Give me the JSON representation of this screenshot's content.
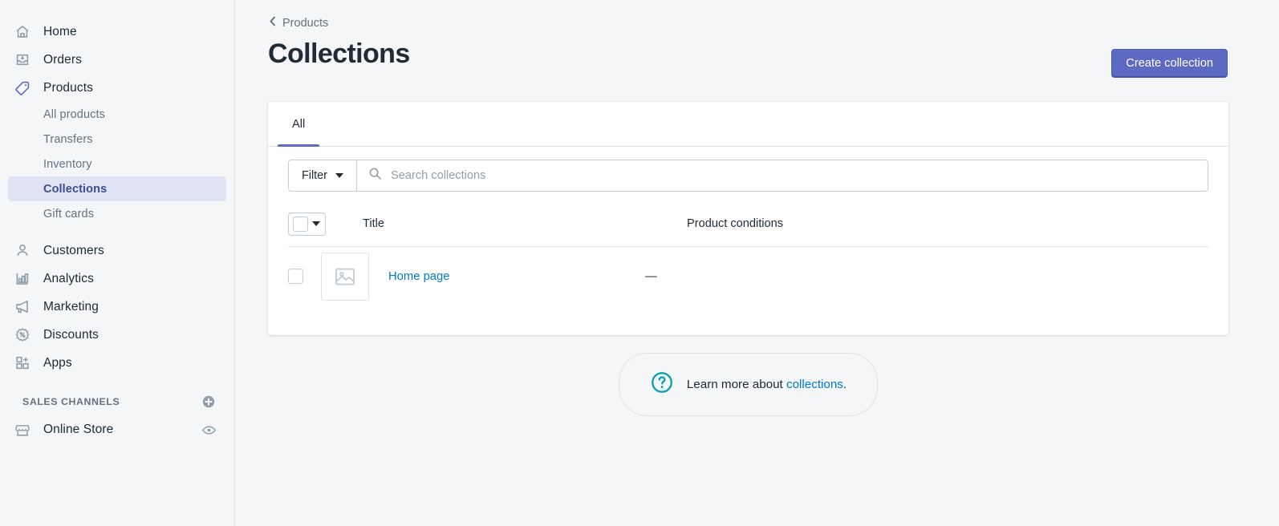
{
  "sidebar": {
    "items": [
      {
        "label": "Home",
        "icon": "home-icon"
      },
      {
        "label": "Orders",
        "icon": "orders-icon"
      },
      {
        "label": "Products",
        "icon": "products-tag-icon"
      }
    ],
    "sub_items": [
      {
        "label": "All products"
      },
      {
        "label": "Transfers"
      },
      {
        "label": "Inventory"
      },
      {
        "label": "Collections"
      },
      {
        "label": "Gift cards"
      }
    ],
    "items2": [
      {
        "label": "Customers",
        "icon": "customers-icon"
      },
      {
        "label": "Analytics",
        "icon": "analytics-icon"
      },
      {
        "label": "Marketing",
        "icon": "marketing-megaphone-icon"
      },
      {
        "label": "Discounts",
        "icon": "discounts-badge-icon"
      },
      {
        "label": "Apps",
        "icon": "apps-icon"
      }
    ],
    "sales_channels": {
      "title": "SALES CHANNELS",
      "add_icon": "plus-circle-icon",
      "channels": [
        {
          "label": "Online Store",
          "icon": "storefront-icon",
          "action_icon": "eye-icon"
        }
      ]
    },
    "active_sub_item": "Collections",
    "active_item": "Products"
  },
  "header": {
    "breadcrumb": "Products",
    "back_icon": "chevron-left-icon",
    "title": "Collections",
    "primary_action": "Create collection"
  },
  "card": {
    "tabs": [
      {
        "label": "All",
        "active": true
      }
    ],
    "filter": {
      "label": "Filter",
      "caret_icon": "chevron-down-icon",
      "search_icon": "search-icon",
      "search_placeholder": "Search collections",
      "search_value": ""
    },
    "table": {
      "columns": [
        "Title",
        "Product conditions"
      ],
      "select_all_icon": "checkbox-dropdown",
      "rows": [
        {
          "title": "Home page",
          "product_conditions": "—",
          "thumbnail_icon": "image-placeholder-icon",
          "checked": false
        }
      ]
    }
  },
  "footer": {
    "help_icon": "question-circle-icon",
    "text_before": "Learn more about ",
    "link_text": "collections",
    "text_after": "."
  },
  "colors": {
    "accent": "#5c6ac4",
    "link": "#007ace",
    "teal": "#00a0ac",
    "page_bg": "#f4f6f8",
    "active_nav_bg": "#dfe3f3"
  }
}
